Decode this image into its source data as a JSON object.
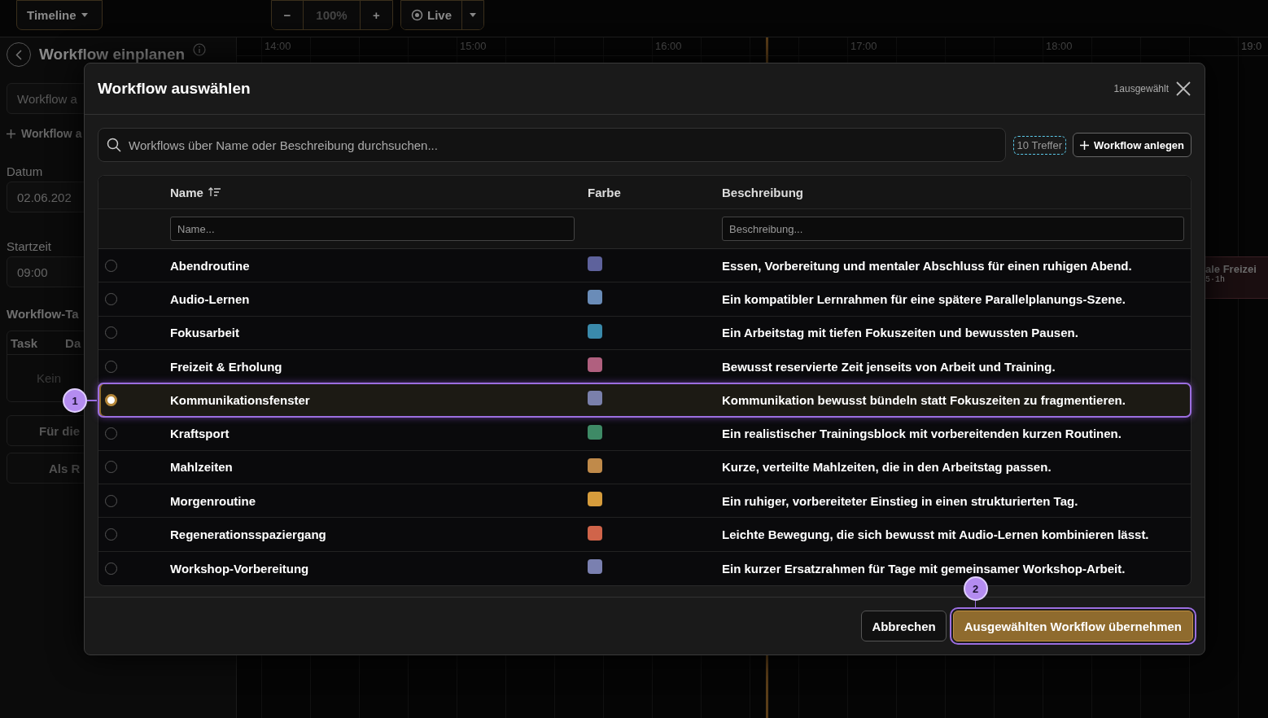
{
  "toolbar": {
    "view_button": "Timeline",
    "zoom_out": "−",
    "zoom_level": "100%",
    "zoom_in": "+",
    "live_button": "Live"
  },
  "sidebar": {
    "title": "Workflow einplanen",
    "workflow_field": {
      "placeholder": "Workflow a"
    },
    "add_workflow": "Workflow a",
    "date_label": "Datum",
    "date_value": "02.06.202",
    "start_label": "Startzeit",
    "start_value": "09:00",
    "tasks_label": "Workflow-Ta",
    "tasks_columns": [
      "Task",
      "Da"
    ],
    "tasks_empty": "Kein",
    "buttons": [
      "Für die",
      "Als R"
    ]
  },
  "timeline": {
    "hours": [
      "14:00",
      "15:00",
      "16:00",
      "17:00",
      "18:00",
      "19:0"
    ],
    "events": [
      {
        "title": "ale Freizei",
        "meta": "5·1h"
      }
    ]
  },
  "dialog": {
    "title": "Workflow auswählen",
    "selection_count": "1ausgewählt",
    "search": {
      "placeholder": "Workflows über Name oder Beschreibung durchsuchen..."
    },
    "result_count": "10 Treffer",
    "create_button": "Workflow anlegen",
    "columns": [
      {
        "label": "Name",
        "sorted": true
      },
      {
        "label": "Farbe",
        "sorted": false
      },
      {
        "label": "Beschreibung",
        "sorted": false
      }
    ],
    "filters": {
      "name": {
        "placeholder": "Name..."
      },
      "description": {
        "placeholder": "Beschreibung..."
      }
    },
    "rows": [
      {
        "name": "Abendroutine",
        "color": "#5e629c",
        "description": "Essen, Vorbereitung und mentaler Abschluss für einen ruhigen Abend.",
        "selected": false
      },
      {
        "name": "Audio-Lernen",
        "color": "#6a8cb8",
        "description": "Ein kompatibler Lernrahmen für eine spätere Parallelplanungs-Szene.",
        "selected": false
      },
      {
        "name": "Fokusarbeit",
        "color": "#3a8aab",
        "description": "Ein Arbeitstag mit tiefen Fokuszeiten und bewussten Pausen.",
        "selected": false
      },
      {
        "name": "Freizeit & Erholung",
        "color": "#b0607f",
        "description": "Bewusst reservierte Zeit jenseits von Arbeit und Training.",
        "selected": false
      },
      {
        "name": "Kommunikationsfenster",
        "color": "#7a80ab",
        "description": "Kommunikation bewusst bündeln statt Fokuszeiten zu fragmentieren.",
        "selected": true
      },
      {
        "name": "Kraftsport",
        "color": "#3e8a66",
        "description": "Ein realistischer Trainingsblock mit vorbereitenden kurzen Routinen.",
        "selected": false
      },
      {
        "name": "Mahlzeiten",
        "color": "#c08a4a",
        "description": "Kurze, verteilte Mahlzeiten, die in den Arbeitstag passen.",
        "selected": false
      },
      {
        "name": "Morgenroutine",
        "color": "#d69c3c",
        "description": "Ein ruhiger, vorbereiteter Einstieg in einen strukturierten Tag.",
        "selected": false
      },
      {
        "name": "Regenerationsspaziergang",
        "color": "#d0644a",
        "description": "Leichte Bewegung, die sich bewusst mit Audio-Lernen kombinieren lässt.",
        "selected": false
      },
      {
        "name": "Workshop-Vorbereitung",
        "color": "#7a80b0",
        "description": "Ein kurzer Ersatzrahmen für Tage mit gemeinsamer Workshop-Arbeit.",
        "selected": false
      }
    ],
    "cancel_button": "Abbrechen",
    "confirm_button": "Ausgewählten Workflow übernehmen"
  },
  "annotations": [
    {
      "kind": "row",
      "label": "1"
    },
    {
      "kind": "button",
      "label": "2"
    }
  ]
}
